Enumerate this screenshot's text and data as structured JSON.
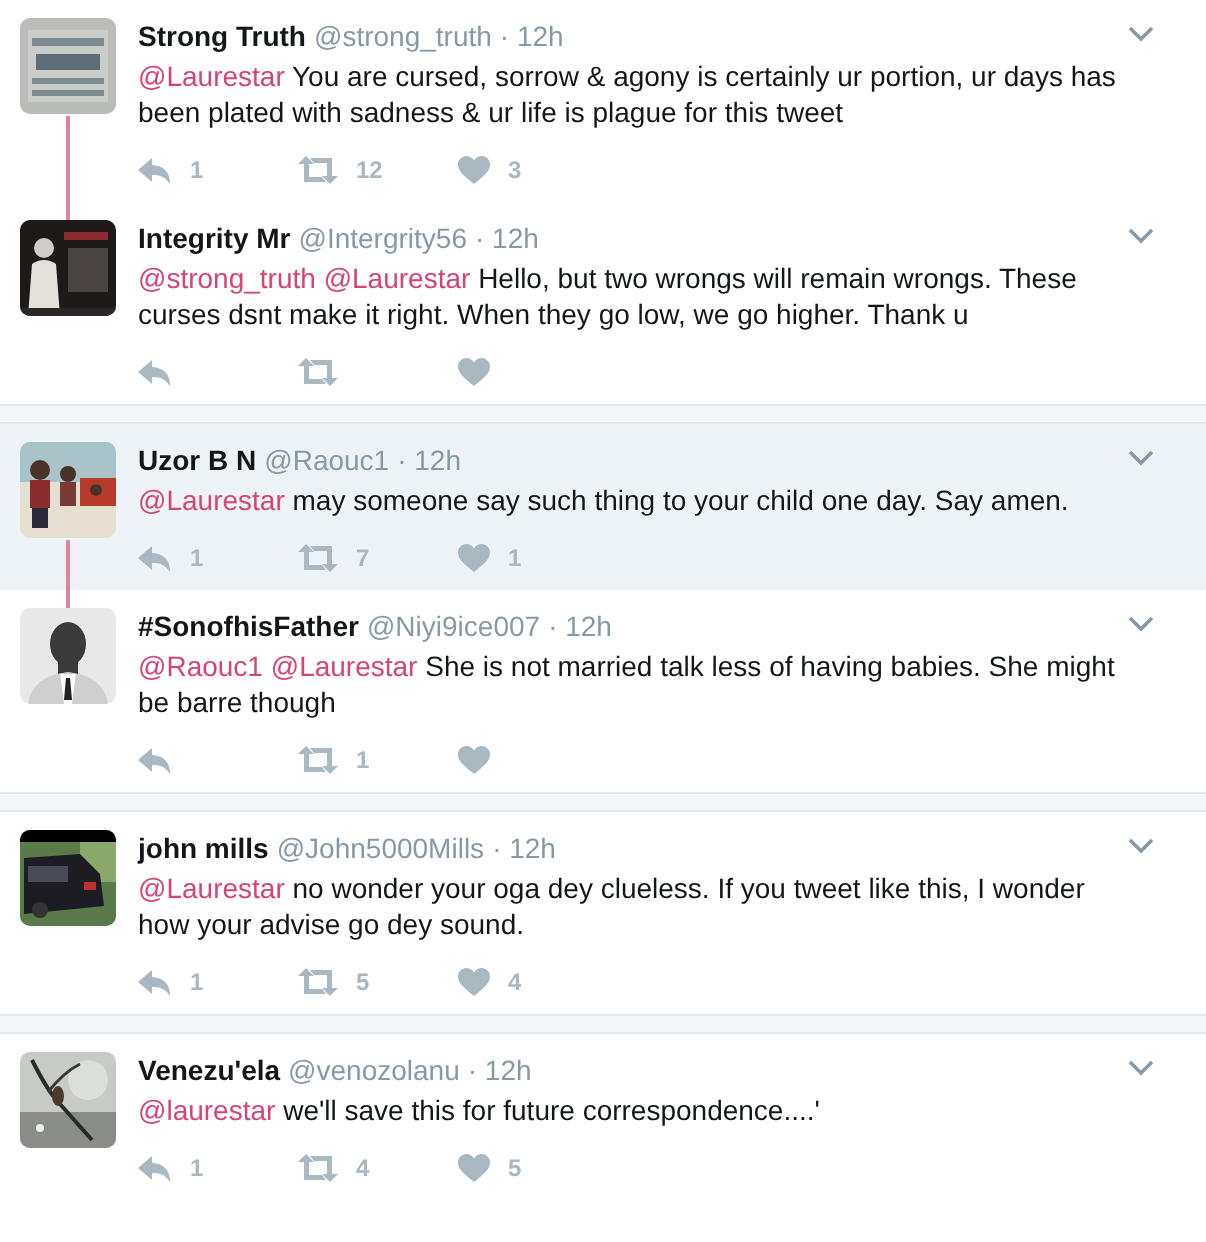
{
  "conversations": [
    {
      "tweets": [
        {
          "name": "Strong Truth",
          "handle": "@strong_truth",
          "time": "· 12h",
          "highlighted": false,
          "mentions": [
            "@Laurestar"
          ],
          "text": "You are cursed, sorrow & agony is certainly ur portion, ur days has been plated with sadness & ur life is plague for this tweet",
          "replies": "1",
          "retweets": "12",
          "likes": "3"
        },
        {
          "name": "Integrity Mr",
          "handle": "@Intergrity56",
          "time": "· 12h",
          "highlighted": false,
          "mentions": [
            "@strong_truth",
            "@Laurestar"
          ],
          "text": "Hello, but two wrongs will remain wrongs. These curses dsnt make it right. When they go low, we go higher. Thank u"
        }
      ]
    },
    {
      "tweets": [
        {
          "name": "Uzor B N",
          "handle": "@Raouc1",
          "time": "· 12h",
          "highlighted": true,
          "mentions": [
            "@Laurestar"
          ],
          "text": "may someone say such thing to your child one day. Say amen.",
          "replies": "1",
          "retweets": "7",
          "likes": "1"
        },
        {
          "name": "#SonofhisFather",
          "handle": "@Niyi9ice007",
          "time": "· 12h",
          "highlighted": false,
          "mentions": [
            "@Raouc1",
            "@Laurestar"
          ],
          "text": "She is not married talk less of having babies. She might be barre though",
          "retweets": "1"
        }
      ]
    },
    {
      "tweets": [
        {
          "name": "john mills",
          "handle": "@John5000Mills",
          "time": "· 12h",
          "highlighted": false,
          "mentions": [
            "@Laurestar"
          ],
          "text": "no wonder your oga dey clueless. If you tweet like this, I wonder how your advise go dey sound.",
          "replies": "1",
          "retweets": "5",
          "likes": "4"
        }
      ]
    },
    {
      "tweets": [
        {
          "name": "Venezu'ela",
          "handle": "@venozolanu",
          "time": "· 12h",
          "highlighted": false,
          "mentions": [
            "@laurestar"
          ],
          "text": "we'll save this for future correspondence....'",
          "replies": "1",
          "retweets": "4",
          "likes": "5"
        }
      ]
    }
  ]
}
